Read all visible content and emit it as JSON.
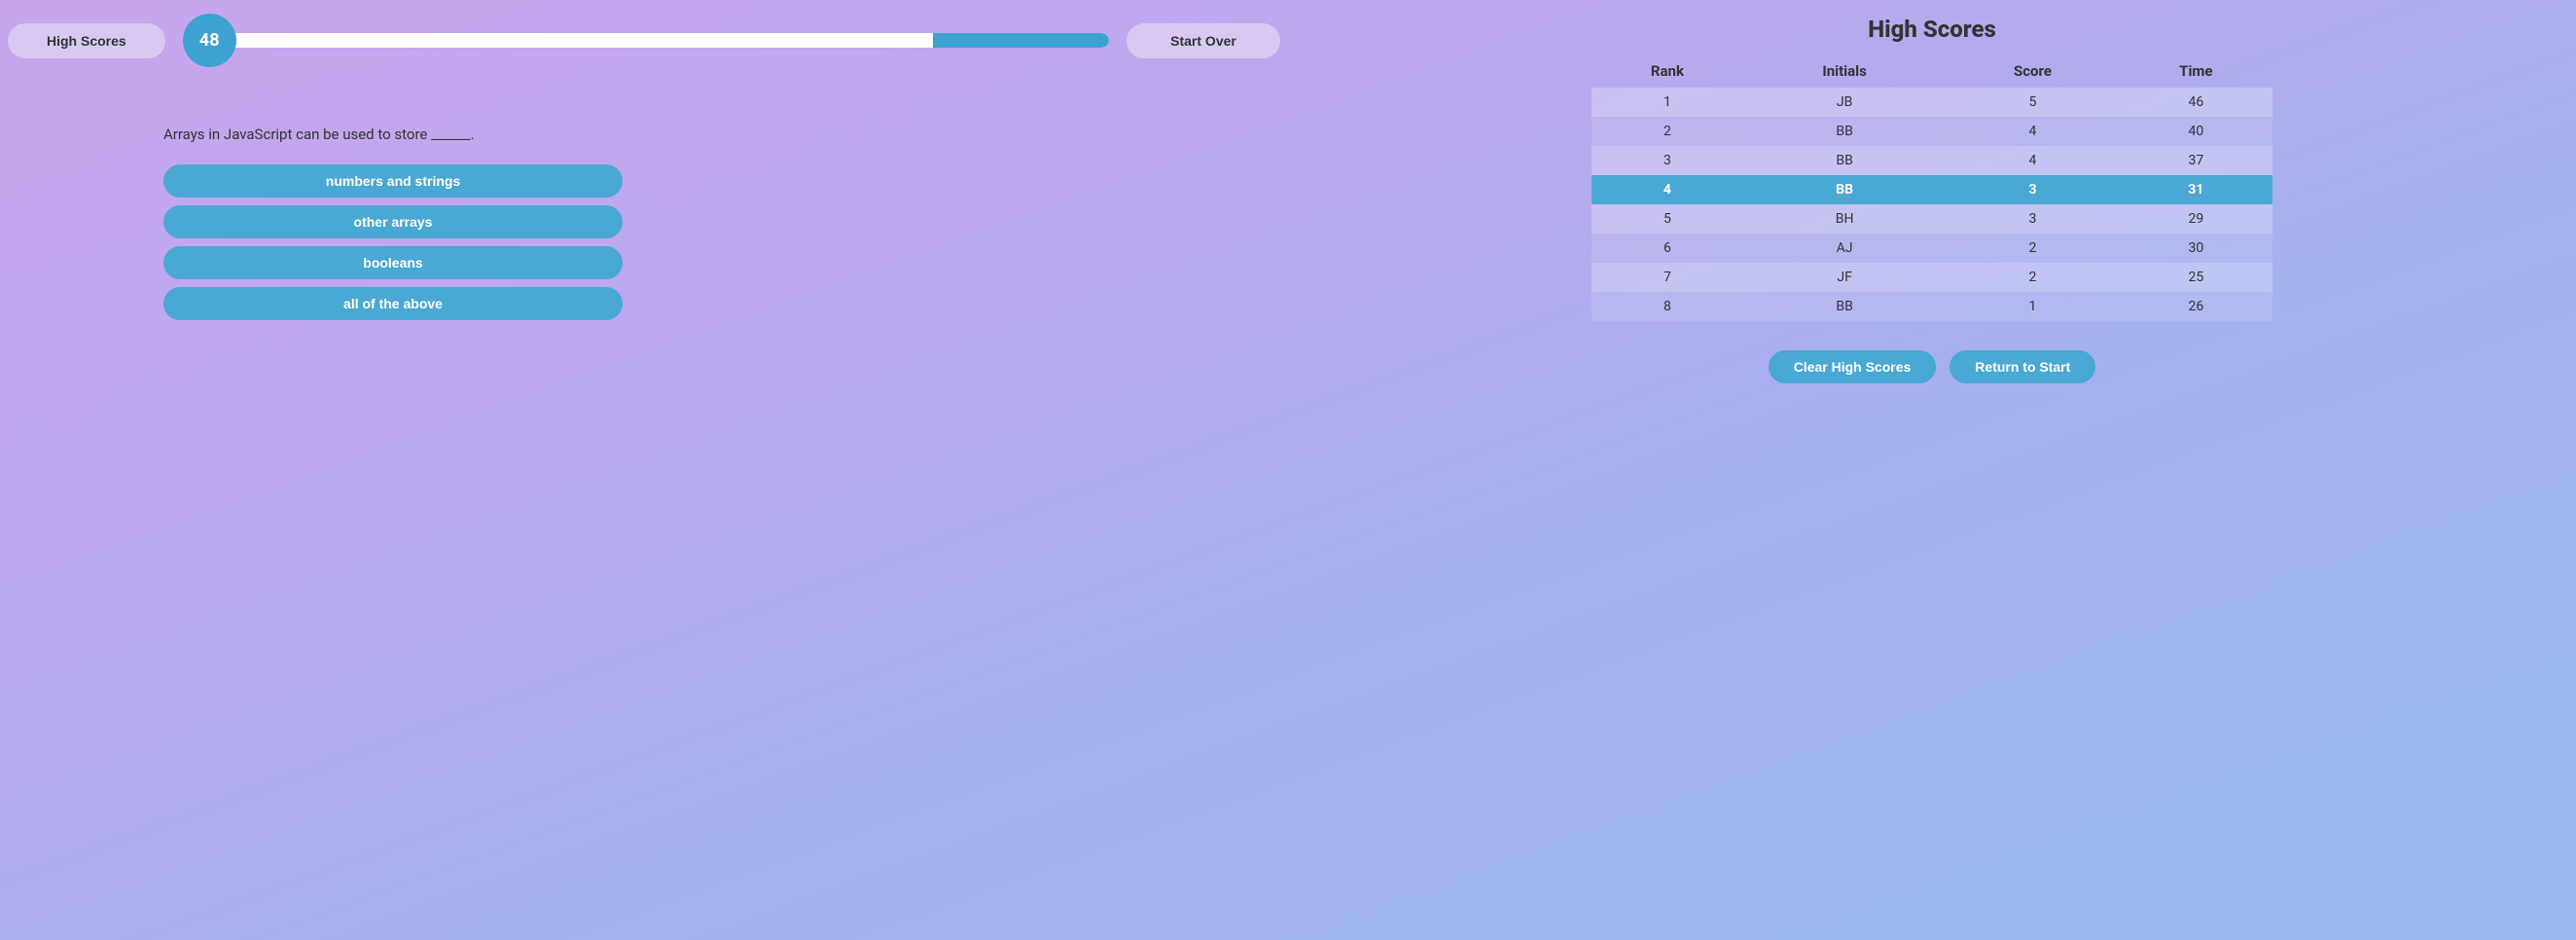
{
  "left": {
    "high_scores_btn": "High Scores",
    "start_over_btn": "Start Over",
    "timer_value": "48",
    "progress_remaining_pct": 20,
    "question": "Arrays in JavaScript can be used to store ______.",
    "answers": [
      "numbers and strings",
      "other arrays",
      "booleans",
      "all of the above"
    ]
  },
  "right": {
    "title": "High Scores",
    "headers": {
      "rank": "Rank",
      "initials": "Initials",
      "score": "Score",
      "time": "Time"
    },
    "rows": [
      {
        "rank": "1",
        "initials": "JB",
        "score": "5",
        "time": "46",
        "highlight": false
      },
      {
        "rank": "2",
        "initials": "BB",
        "score": "4",
        "time": "40",
        "highlight": false
      },
      {
        "rank": "3",
        "initials": "BB",
        "score": "4",
        "time": "37",
        "highlight": false
      },
      {
        "rank": "4",
        "initials": "BB",
        "score": "3",
        "time": "31",
        "highlight": true
      },
      {
        "rank": "5",
        "initials": "BH",
        "score": "3",
        "time": "29",
        "highlight": false
      },
      {
        "rank": "6",
        "initials": "AJ",
        "score": "2",
        "time": "30",
        "highlight": false
      },
      {
        "rank": "7",
        "initials": "JF",
        "score": "2",
        "time": "25",
        "highlight": false
      },
      {
        "rank": "8",
        "initials": "BB",
        "score": "1",
        "time": "26",
        "highlight": false
      }
    ],
    "clear_btn": "Clear High Scores",
    "return_btn": "Return to Start"
  },
  "colors": {
    "accent": "#4aa8d4",
    "pill_bg": "#d8c9f2"
  }
}
